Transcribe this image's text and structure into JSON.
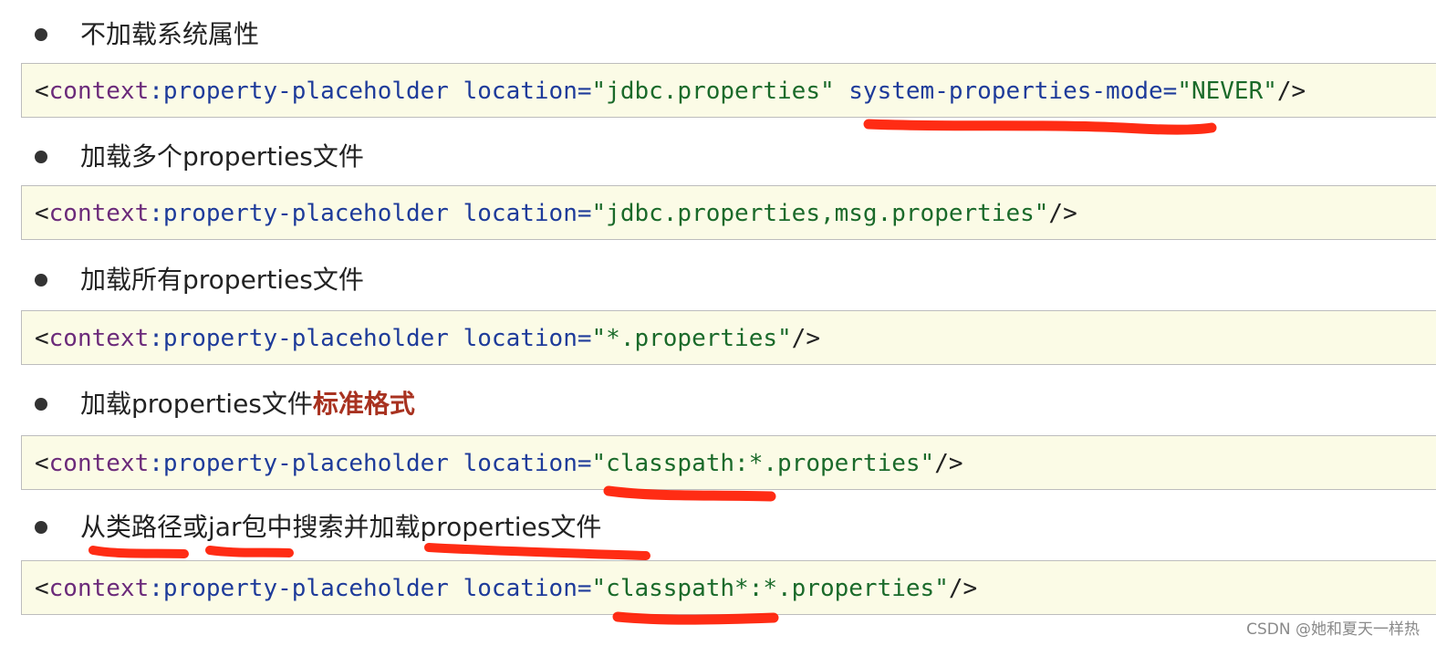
{
  "sections": [
    {
      "bullet": "不加载系统属性",
      "code": {
        "open": "<",
        "ns": "context",
        "colon": ":",
        "tag": "property-placeholder",
        "attr1_name": "location",
        "attr1_eq": "=",
        "attr1_value": "\"jdbc.properties\"",
        "attr2_name": "system-properties-mode",
        "attr2_eq": "=",
        "attr2_value": "\"NEVER\"",
        "close": "/>"
      }
    },
    {
      "bullet": "加载多个properties文件",
      "code": {
        "open": "<",
        "ns": "context",
        "colon": ":",
        "tag": "property-placeholder",
        "attr1_name": "location",
        "attr1_eq": "=",
        "attr1_value": "\"jdbc.properties,msg.properties\"",
        "close": "/>"
      }
    },
    {
      "bullet": "加载所有properties文件",
      "code": {
        "open": "<",
        "ns": "context",
        "colon": ":",
        "tag": "property-placeholder",
        "attr1_name": "location",
        "attr1_eq": "=",
        "attr1_value": "\"*.properties\"",
        "close": "/>"
      }
    },
    {
      "bullet_plain": "加载properties文件",
      "bullet_emph": "标准格式",
      "code": {
        "open": "<",
        "ns": "context",
        "colon": ":",
        "tag": "property-placeholder",
        "attr1_name": "location",
        "attr1_eq": "=",
        "attr1_value": "\"classpath:*.properties\"",
        "close": "/>"
      }
    },
    {
      "bullet": "从类路径或jar包中搜索并加载properties文件",
      "code": {
        "open": "<",
        "ns": "context",
        "colon": ":",
        "tag": "property-placeholder",
        "attr1_name": "location",
        "attr1_eq": "=",
        "attr1_value": "\"classpath*:*.properties\"",
        "close": "/>"
      }
    }
  ],
  "watermark": "CSDN @她和夏天一样热",
  "colors": {
    "code_background": "#fbfbe6",
    "namespace": "#6b2a7a",
    "tag_and_attr": "#1e3b9a",
    "value": "#1a6a2a",
    "emphasis": "#a83220",
    "underline_mark": "#ff1a00"
  }
}
